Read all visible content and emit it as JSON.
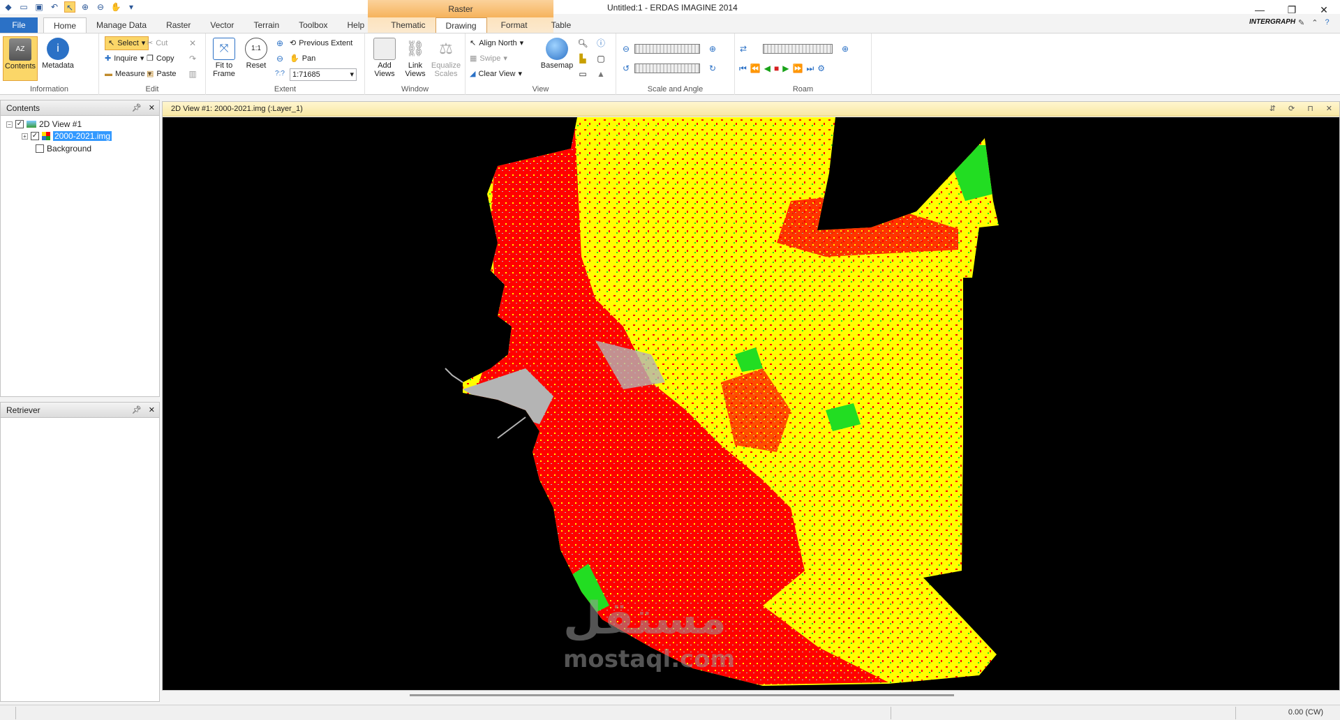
{
  "window": {
    "title": "Untitled:1 - ERDAS IMAGINE 2014",
    "brand": "INTERGRAPH"
  },
  "context_group": {
    "label": "Raster"
  },
  "tabs": [
    {
      "label": "File"
    },
    {
      "label": "Home"
    },
    {
      "label": "Manage Data"
    },
    {
      "label": "Raster"
    },
    {
      "label": "Vector"
    },
    {
      "label": "Terrain"
    },
    {
      "label": "Toolbox"
    },
    {
      "label": "Help"
    },
    {
      "label": "Thematic"
    },
    {
      "label": "Drawing"
    },
    {
      "label": "Format"
    },
    {
      "label": "Table"
    }
  ],
  "ribbon": {
    "information": {
      "label": "Information",
      "contents": "Contents",
      "metadata": "Metadata"
    },
    "edit": {
      "label": "Edit",
      "select": "Select",
      "inquire": "Inquire",
      "measure": "Measure",
      "cut": "Cut",
      "copy": "Copy",
      "paste": "Paste"
    },
    "extent": {
      "label": "Extent",
      "fit_to_frame": "Fit to\nFrame",
      "reset": "Reset",
      "previous_extent": "Previous Extent",
      "pan": "Pan",
      "scale_value": "1:71685"
    },
    "window": {
      "label": "Window",
      "add_views": "Add\nViews",
      "link_views": "Link\nViews",
      "equalize_scales": "Equalize\nScales"
    },
    "view": {
      "label": "View",
      "align_north": "Align North",
      "swipe": "Swipe",
      "clear_view": "Clear View",
      "basemap": "Basemap"
    },
    "scale_angle": {
      "label": "Scale and Angle"
    },
    "roam": {
      "label": "Roam"
    }
  },
  "contents_panel": {
    "title": "Contents",
    "items": [
      {
        "label": "2D View #1"
      },
      {
        "label": "2000-2021.img"
      },
      {
        "label": "Background"
      }
    ]
  },
  "retriever_panel": {
    "title": "Retriever"
  },
  "view": {
    "title": "2D View #1: 2000-2021.img (:Layer_1)",
    "watermark": "مستقل",
    "watermark_url": "mostaql.com"
  },
  "status": {
    "rotation": "0.00 (CW)"
  },
  "colors": {
    "class_built": "#ff0000",
    "class_agri": "#ffff00",
    "class_veg": "#22dd22",
    "class_bare": "#b4b4b4",
    "background": "#000000",
    "accent": "#2b71c6"
  }
}
